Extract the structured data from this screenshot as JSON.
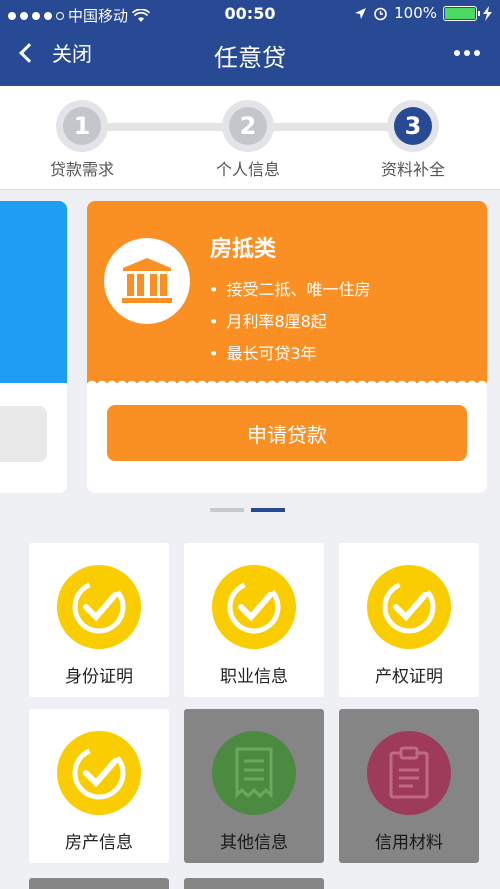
{
  "status_bar": {
    "carrier": "中国移动",
    "time": "00:50",
    "battery": "100%"
  },
  "nav": {
    "back_label": "关闭",
    "title": "任意贷"
  },
  "stepper": {
    "steps": [
      {
        "number": "1",
        "label": "贷款需求"
      },
      {
        "number": "2",
        "label": "个人信息"
      },
      {
        "number": "3",
        "label": "资料补全"
      }
    ],
    "active_step": 3
  },
  "loan_card": {
    "name": "房抵类",
    "features": [
      "接受二抵、唯一住房",
      "月利率8厘8起",
      "最长可贷3年"
    ],
    "apply_label": "申请贷款",
    "accent_color": "#fa8f23"
  },
  "pager": {
    "count": 2,
    "active": 2
  },
  "documents": [
    {
      "label": "身份证明",
      "icon": "check-badge-icon",
      "status": "completed"
    },
    {
      "label": "职业信息",
      "icon": "check-badge-icon",
      "status": "completed"
    },
    {
      "label": "产权证明",
      "icon": "check-badge-icon",
      "status": "completed"
    },
    {
      "label": "房产信息",
      "icon": "check-badge-icon",
      "status": "completed"
    },
    {
      "label": "其他信息",
      "icon": "receipt-icon",
      "status": "pending"
    },
    {
      "label": "信用材料",
      "icon": "clipboard-icon",
      "status": "pending"
    }
  ]
}
